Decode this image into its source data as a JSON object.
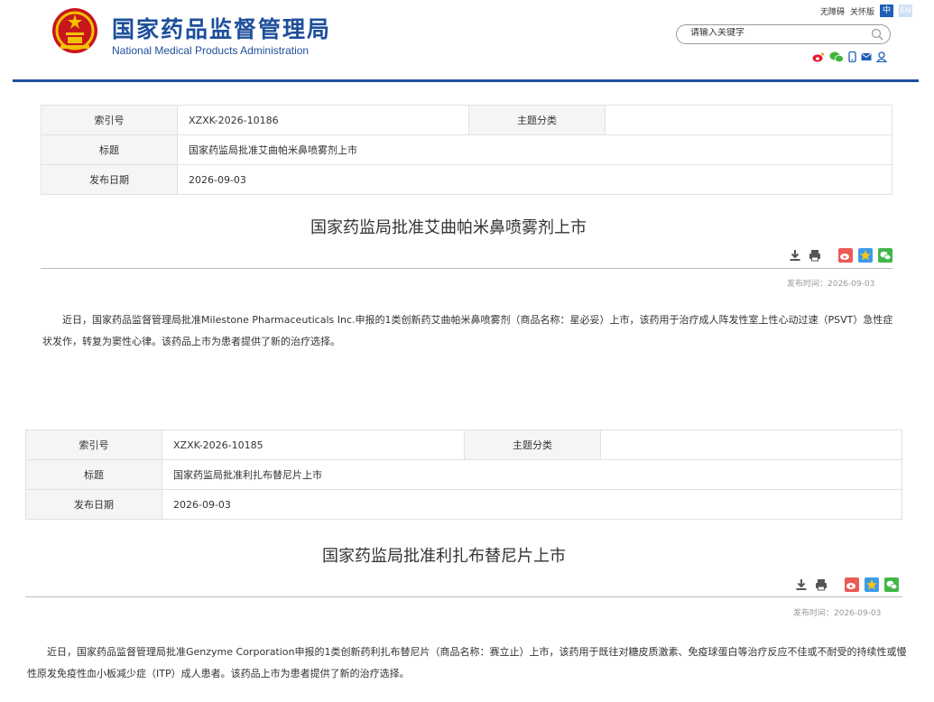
{
  "header": {
    "logo_cn": "国家药品监督管理局",
    "logo_en": "National Medical Products Administration",
    "toplinks": {
      "accessibility": "无障碍",
      "care": "关怀版",
      "lang_zh": "中",
      "lang_en": "EN"
    },
    "search_placeholder": "请输入关键字",
    "social_icons": [
      "weibo-icon",
      "wechat-icon",
      "mobile-icon",
      "mail-icon",
      "user-icon"
    ]
  },
  "articles": [
    {
      "meta": {
        "index_label": "索引号",
        "index_value": "XZXK-2026-10186",
        "category_label": "主题分类",
        "category_value": "",
        "title_label": "标题",
        "title_value": "国家药监局批准艾曲帕米鼻喷雾剂上市",
        "date_label": "发布日期",
        "date_value": "2026-09-03"
      },
      "title": "国家药监局批准艾曲帕米鼻喷雾剂上市",
      "pubtime": "发布时间：2026-09-03",
      "body": "近日，国家药品监督管理局批准Milestone Pharmaceuticals Inc.申报的1类创新药艾曲帕米鼻喷雾剂（商品名称：星必妥）上市，该药用于治疗成人阵发性室上性心动过速（PSVT）急性症状发作，转复为窦性心律。该药品上市为患者提供了新的治疗选择。"
    },
    {
      "meta": {
        "index_label": "索引号",
        "index_value": "XZXK-2026-10185",
        "category_label": "主题分类",
        "category_value": "",
        "title_label": "标题",
        "title_value": "国家药监局批准利扎布替尼片上市",
        "date_label": "发布日期",
        "date_value": "2026-09-03"
      },
      "title": "国家药监局批准利扎布替尼片上市",
      "pubtime": "发布时间：2026-09-03",
      "body": "近日，国家药品监督管理局批准Genzyme Corporation申报的1类创新药利扎布替尼片（商品名称：赛立止）上市，该药用于既往对糖皮质激素、免疫球蛋白等治疗反应不佳或不耐受的持续性或慢性原发免疫性血小板减少症（ITP）成人患者。该药品上市为患者提供了新的治疗选择。"
    }
  ]
}
